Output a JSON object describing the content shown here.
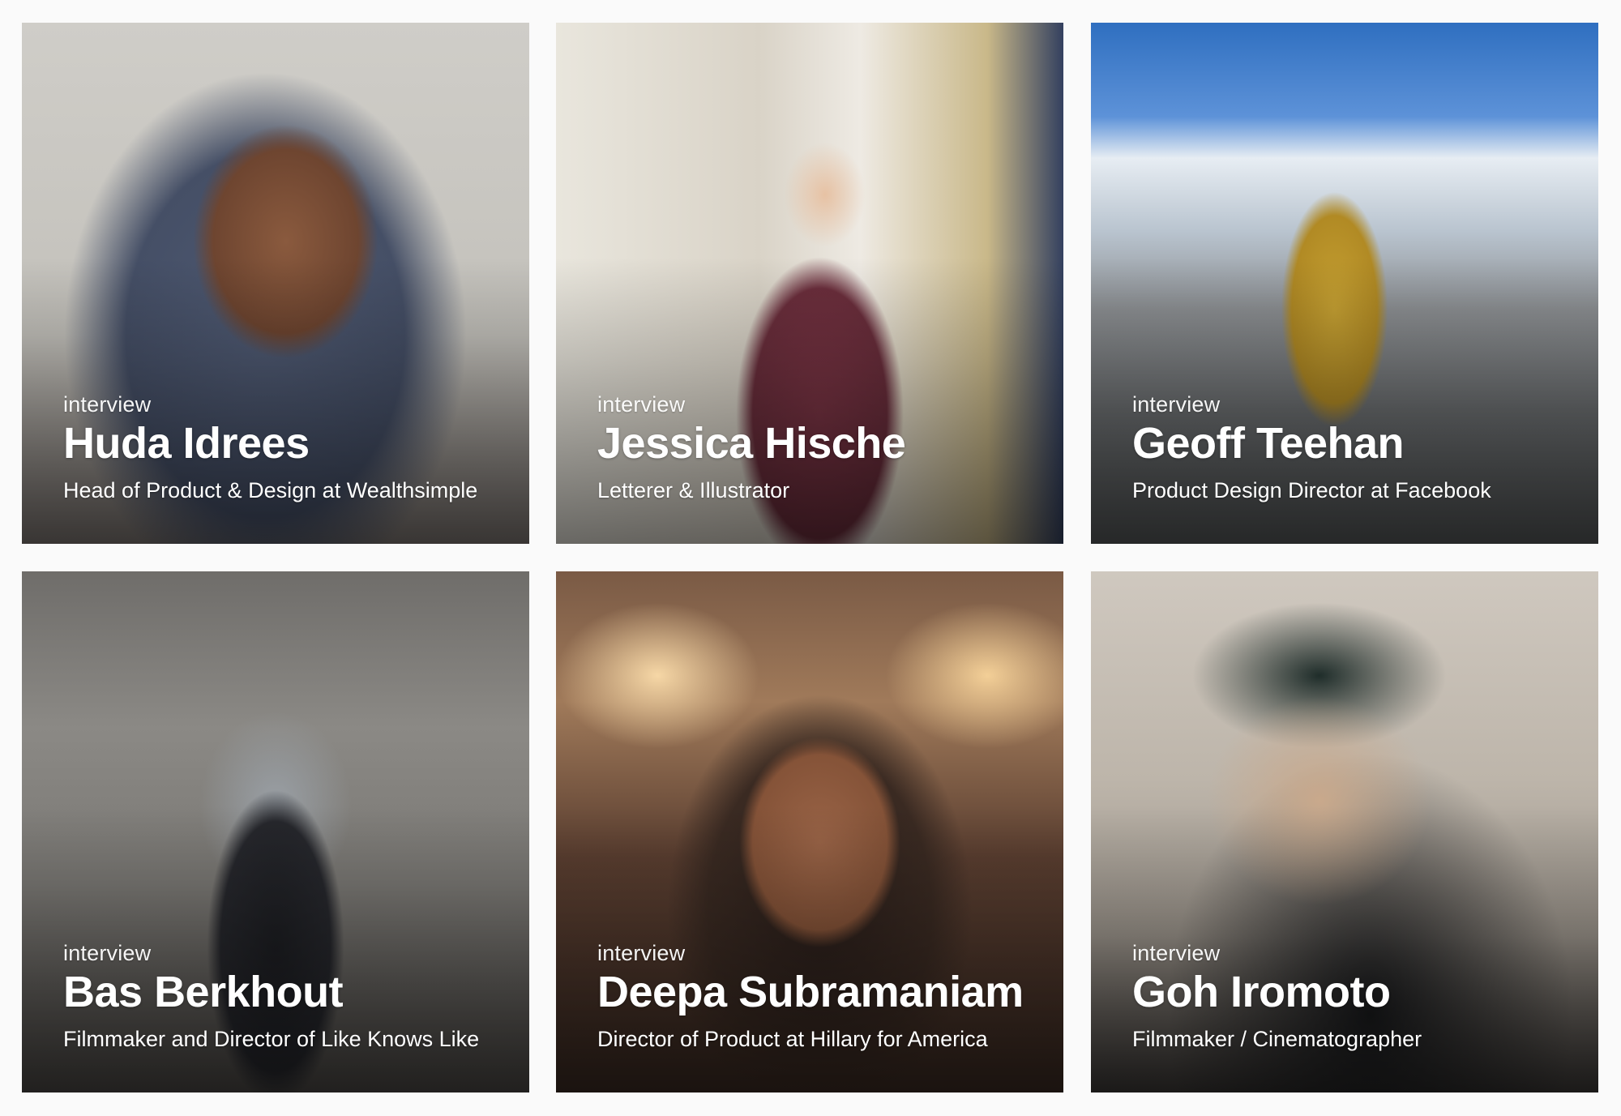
{
  "cards": [
    {
      "kicker": "interview",
      "name": "Huda Idrees",
      "role": "Head of Product & Design at Wealthsimple"
    },
    {
      "kicker": "interview",
      "name": "Jessica Hische",
      "role": "Letterer & Illustrator"
    },
    {
      "kicker": "interview",
      "name": "Geoff Teehan",
      "role": "Product Design Director at Facebook"
    },
    {
      "kicker": "interview",
      "name": "Bas Berkhout",
      "role": "Filmmaker and Director of Like Knows Like"
    },
    {
      "kicker": "interview",
      "name": "Deepa Subramaniam",
      "role": "Director of Product at Hillary for America"
    },
    {
      "kicker": "interview",
      "name": "Goh Iromoto",
      "role": "Filmmaker / Cinematographer"
    }
  ]
}
